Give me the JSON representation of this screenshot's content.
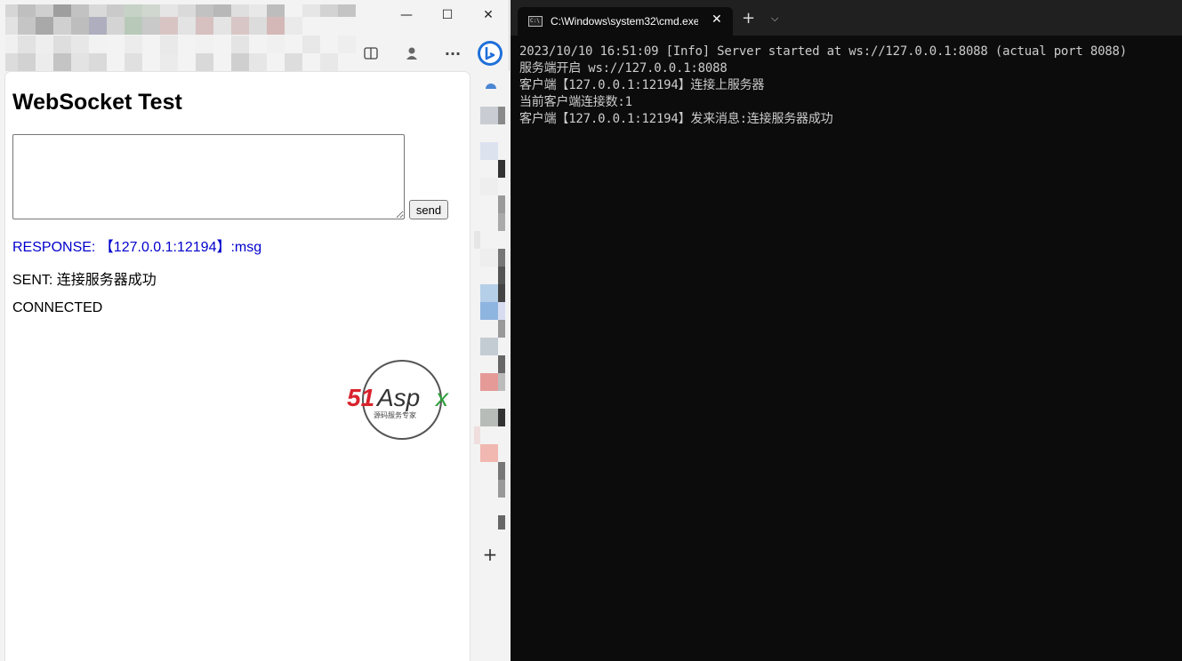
{
  "browser": {
    "window_controls": {
      "minimize": "—",
      "maximize": "☐",
      "close": "✕"
    },
    "toolbar_icons": [
      "split-screen-icon",
      "profile-icon",
      "more-options-icon",
      "copilot-icon"
    ],
    "more_label": "···",
    "page": {
      "title": "WebSocket Test",
      "textarea_value": "",
      "send_label": "send",
      "log": [
        {
          "text": "RESPONSE: 【127.0.0.1:12194】:msg",
          "color": "#0000cc"
        },
        {
          "text": "SENT: 连接服务器成功",
          "color": "#000000"
        },
        {
          "text": "CONNECTED",
          "color": "#000000"
        }
      ]
    },
    "sidebar": {
      "add_label": "+"
    }
  },
  "terminal": {
    "tab_title": "C:\\Windows\\system32\\cmd.exe",
    "tab_icon_text": "C:\\",
    "close_label": "✕",
    "new_tab_label": "+",
    "dropdown_label": "⌵",
    "lines": [
      "2023/10/10 16:51:09 [Info] Server started at ws://127.0.0.1:8088 (actual port 8088)",
      "服务端开启 ws://127.0.0.1:8088",
      "客户端【127.0.0.1:12194】连接上服务器",
      "当前客户端连接数:1",
      "客户端【127.0.0.1:12194】发来消息:连接服务器成功"
    ]
  },
  "colors": {
    "terminal_bg": "#0c0c0c",
    "terminal_text": "#cccccc",
    "response_blue": "#0000cc",
    "copilot_blue": "#1e6fd9"
  }
}
